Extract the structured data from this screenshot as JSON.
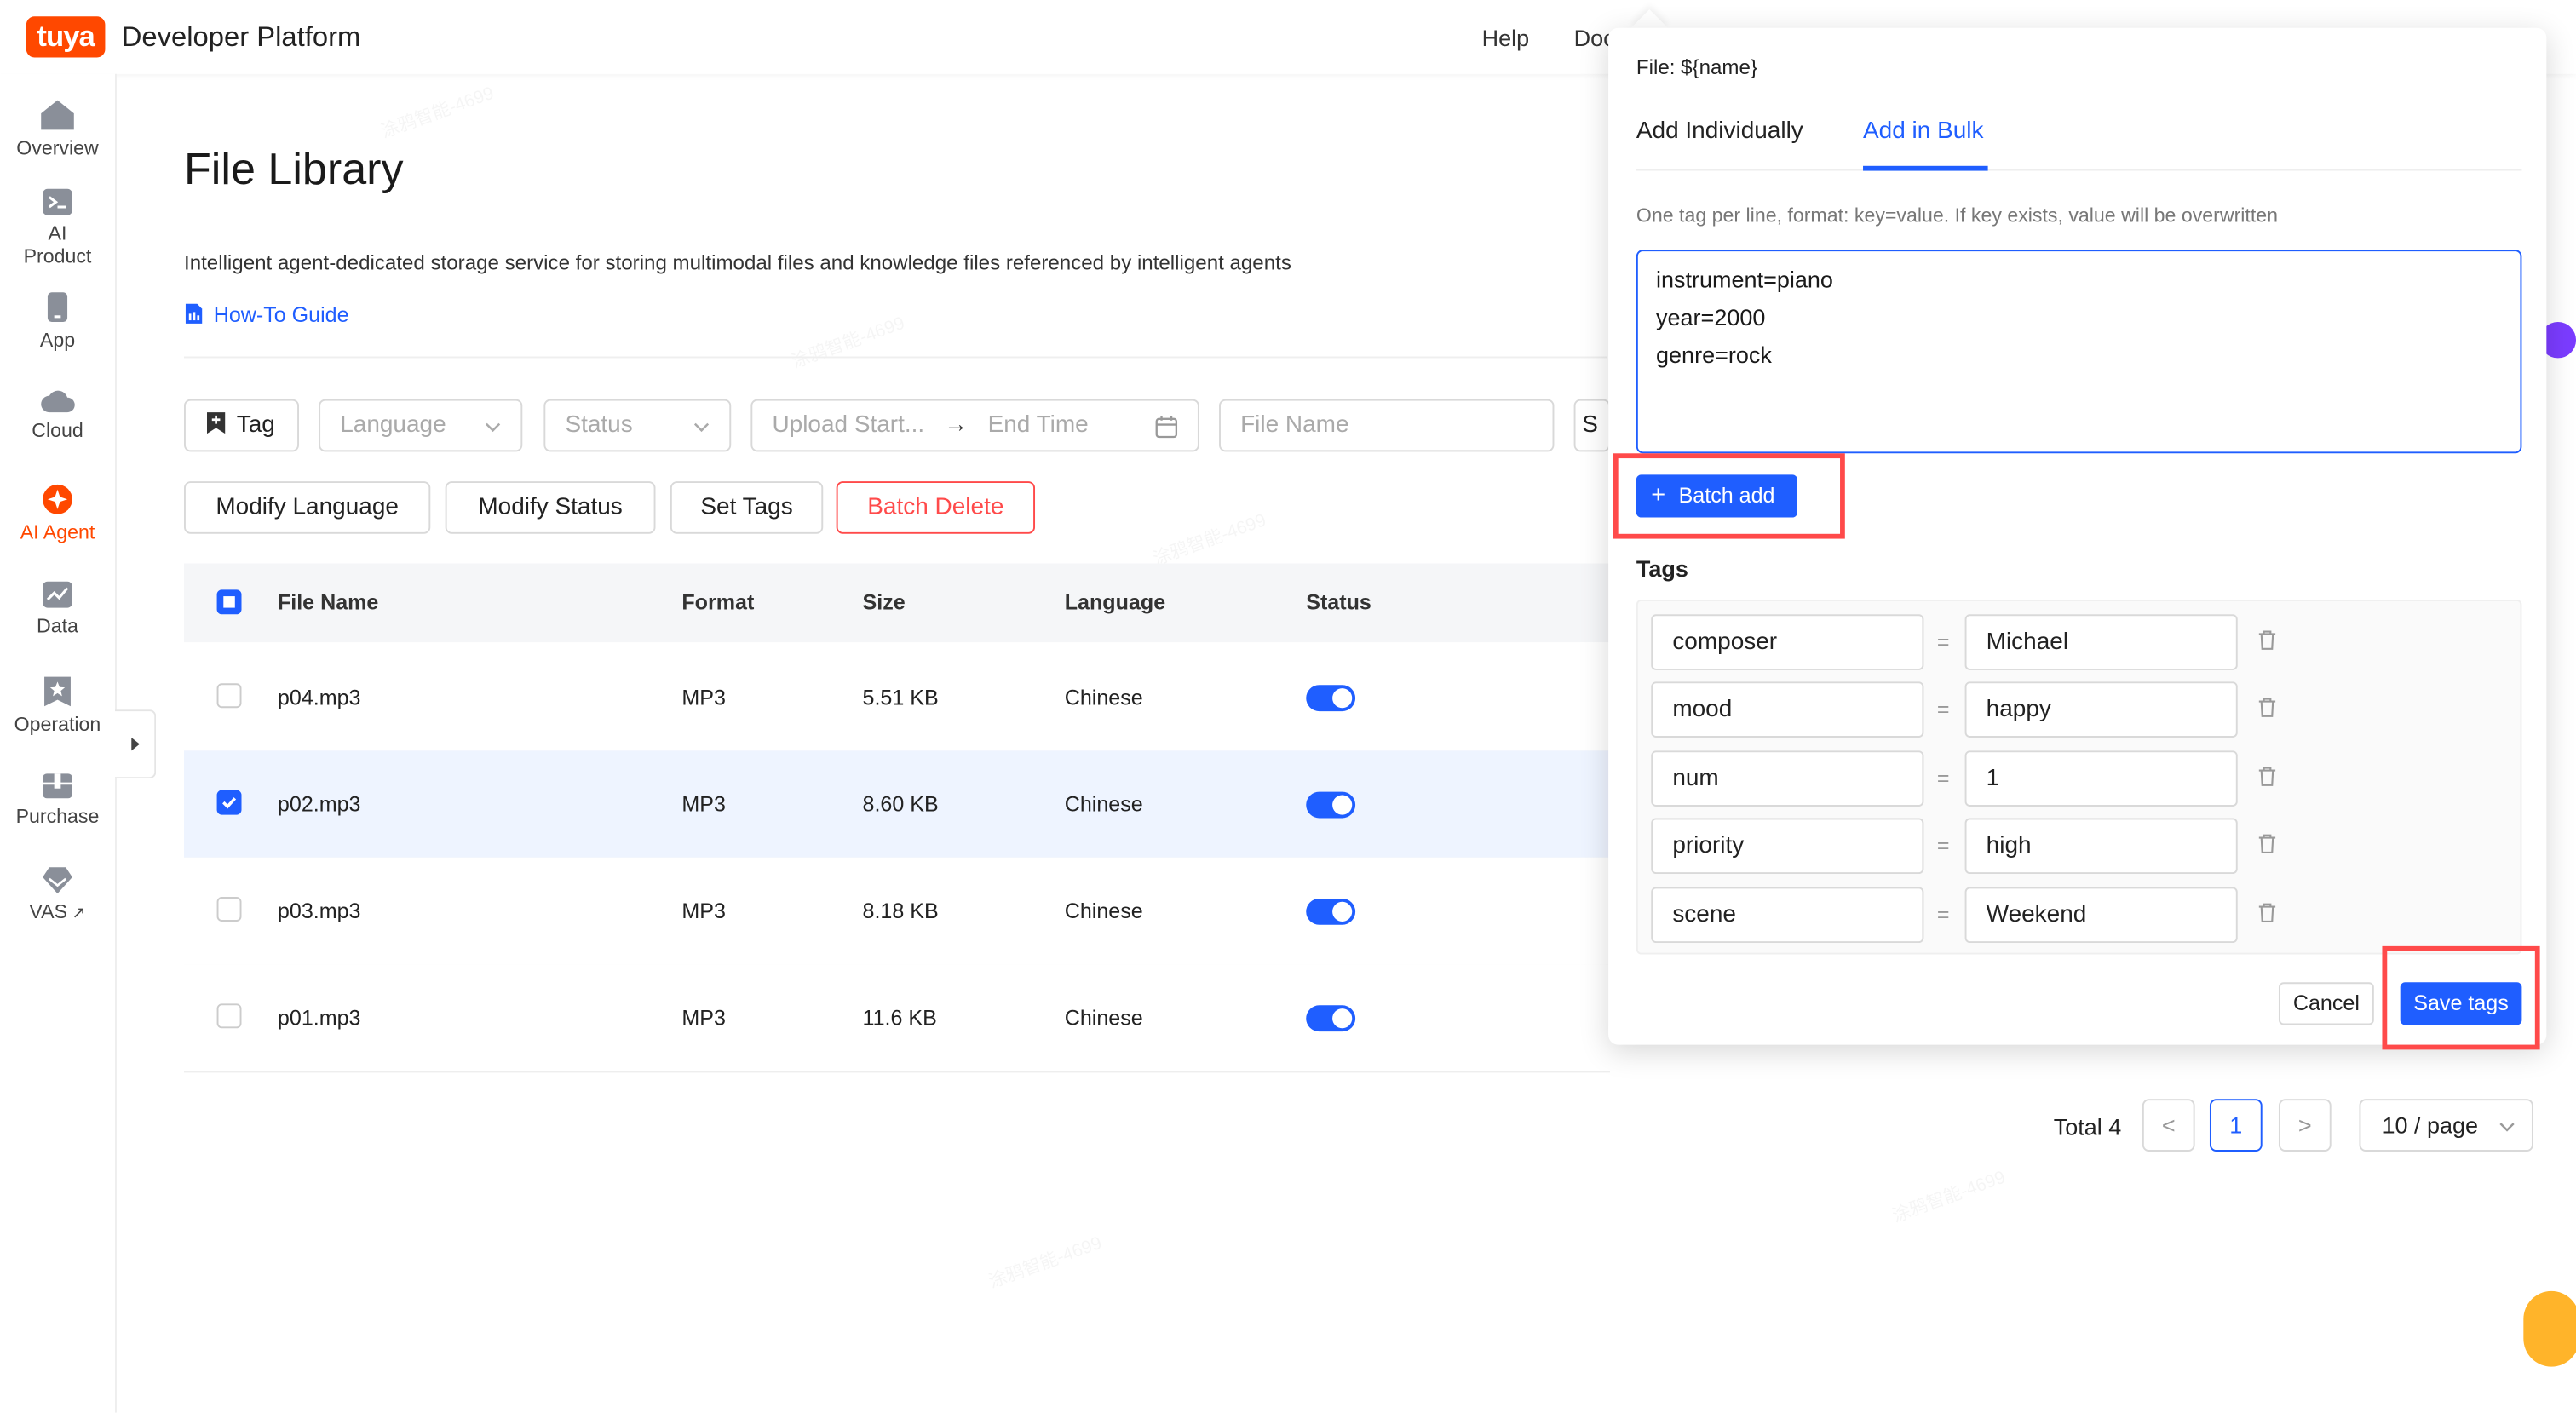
{
  "header": {
    "logo_text": "tuya",
    "platform": "Developer Platform",
    "help": "Help",
    "docs": "Docs"
  },
  "sidebar": {
    "items": [
      {
        "label": "Overview",
        "icon": "home-icon"
      },
      {
        "label": "AI Product",
        "icon": "terminal-icon"
      },
      {
        "label": "App",
        "icon": "phone-icon"
      },
      {
        "label": "Cloud",
        "icon": "cloud-icon"
      },
      {
        "label": "AI Agent",
        "icon": "sparkle-icon",
        "active": true
      },
      {
        "label": "Data",
        "icon": "chart-icon"
      },
      {
        "label": "Operation",
        "icon": "star-badge-icon"
      },
      {
        "label": "Purchase",
        "icon": "box-icon"
      },
      {
        "label": "VAS",
        "icon": "diamond-icon"
      }
    ]
  },
  "page": {
    "title": "File Library",
    "description": "Intelligent agent-dedicated storage service for storing multimodal files and knowledge files referenced by intelligent agents",
    "guide": "How-To Guide"
  },
  "filters": {
    "tag": "Tag",
    "language_placeholder": "Language",
    "status_placeholder": "Status",
    "start_placeholder": "Upload Start...",
    "end_placeholder": "End Time",
    "filename_placeholder": "File Name",
    "cut_letter": "S"
  },
  "actions": {
    "modify_language": "Modify Language",
    "modify_status": "Modify Status",
    "set_tags": "Set Tags",
    "batch_delete": "Batch Delete"
  },
  "table": {
    "columns": [
      "File Name",
      "Format",
      "Size",
      "Language",
      "Status"
    ],
    "rows": [
      {
        "name": "p04.mp3",
        "format": "MP3",
        "size": "5.51 KB",
        "language": "Chinese",
        "checked": false,
        "enabled": true
      },
      {
        "name": "p02.mp3",
        "format": "MP3",
        "size": "8.60 KB",
        "language": "Chinese",
        "checked": true,
        "enabled": true
      },
      {
        "name": "p03.mp3",
        "format": "MP3",
        "size": "8.18 KB",
        "language": "Chinese",
        "checked": false,
        "enabled": true
      },
      {
        "name": "p01.mp3",
        "format": "MP3",
        "size": "11.6 KB",
        "language": "Chinese",
        "checked": false,
        "enabled": true
      }
    ]
  },
  "pagination": {
    "total": "Total 4",
    "prev": "<",
    "current": "1",
    "next": ">",
    "page_size": "10 / page"
  },
  "popover": {
    "file": "File: ${name}",
    "tabs": [
      "Add Individually",
      "Add in Bulk"
    ],
    "active_tab": "Add in Bulk",
    "hint": "One tag per line, format: key=value. If key exists, value will be overwritten",
    "bulk_text": "instrument=piano\nyear=2000\ngenre=rock",
    "batch_add": "Batch add",
    "tags_label": "Tags",
    "tags": [
      {
        "key": "composer",
        "value": "Michael"
      },
      {
        "key": "mood",
        "value": "happy"
      },
      {
        "key": "num",
        "value": "1"
      },
      {
        "key": "priority",
        "value": "high"
      },
      {
        "key": "scene",
        "value": "Weekend"
      }
    ],
    "equals": "=",
    "cancel": "Cancel",
    "save": "Save tags"
  },
  "colors": {
    "brand": "#ff4800",
    "primary": "#1f5eff",
    "danger": "#ff4a4a"
  }
}
